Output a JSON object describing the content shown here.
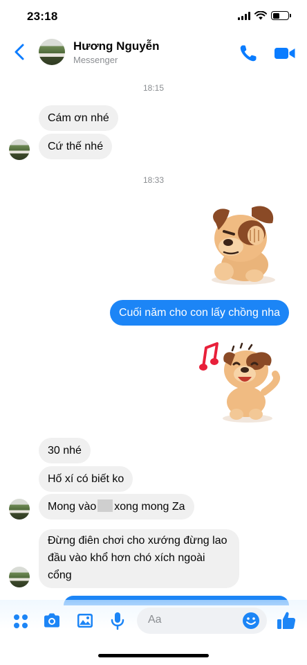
{
  "status_bar": {
    "time": "23:18",
    "battery_level": 0.45
  },
  "header": {
    "name": "Hương Nguyễn",
    "subtitle": "Messenger",
    "accent_color": "#0a7cff"
  },
  "messages": {
    "ts1": "18:15",
    "in1": "Cám ơn nhé",
    "in2": "Cứ thế nhé",
    "ts2": "18:33",
    "out1": "Cuối năm cho con lấy chồng nha",
    "in3": "30 nhé",
    "in4": "Hố xí có biết ko",
    "in5_a": "Mong vào",
    "in5_b": "xong mong Za",
    "in6": "Đừng điên chơi cho xướng đừng lao đầu vào khổ hơn chó xích ngoài cổng"
  },
  "stickers": {
    "sticker1": "dog-facepalm-sticker",
    "sticker2": "dog-singing-sticker"
  },
  "composer": {
    "placeholder": "Aa",
    "icons": [
      "apps-icon",
      "camera-icon",
      "gallery-icon",
      "microphone-icon",
      "emoji-icon",
      "thumbs-up-icon"
    ]
  },
  "colors": {
    "outgoing_bubble": "#1c85f6",
    "incoming_bubble": "#f0f0f0",
    "timestamp": "#8a8d91"
  }
}
